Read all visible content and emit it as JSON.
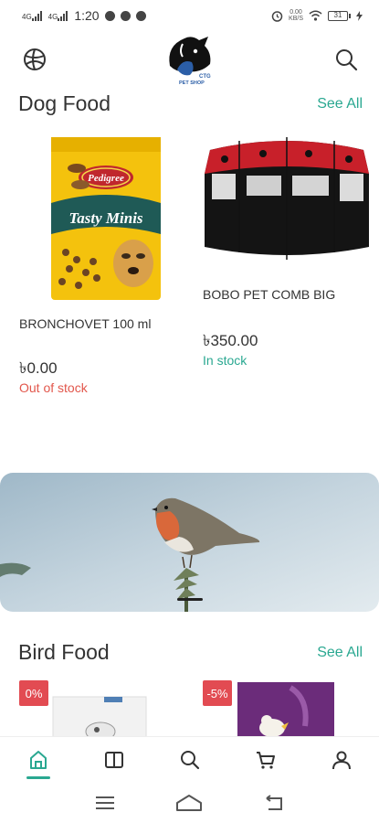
{
  "status_bar": {
    "time": "1:20",
    "signal1_label": "4G",
    "signal2_label": "4G",
    "net_speed_value": "0.00",
    "net_speed_unit": "KB/S",
    "battery_level": "31"
  },
  "header": {
    "logo_line1": "CTG",
    "logo_line2": "PET SHOP"
  },
  "sections": {
    "dog_food": {
      "title": "Dog Food",
      "see_all": "See All",
      "products": [
        {
          "name": "BRONCHOVET 100 ml",
          "price": "৳0.00",
          "stock": "Out of stock",
          "stock_color": "#e2574c",
          "pack_brand": "Pedigree",
          "pack_product": "Tasty Minis"
        },
        {
          "name": "BOBO PET COMB BIG",
          "price": "৳350.00",
          "stock": "In stock",
          "stock_color": "#2aa891"
        }
      ]
    },
    "bird_food": {
      "title": "Bird Food",
      "see_all": "See All",
      "products": [
        {
          "badge": "0%"
        },
        {
          "badge": "-5%"
        }
      ]
    }
  },
  "colors": {
    "accent": "#2aa891",
    "badge": "#e24b52",
    "out_of_stock": "#e2574c"
  },
  "bottom_nav": [
    {
      "icon": "home-icon",
      "active": true
    },
    {
      "icon": "book-icon",
      "active": false
    },
    {
      "icon": "search-icon",
      "active": false
    },
    {
      "icon": "cart-icon",
      "active": false
    },
    {
      "icon": "user-icon",
      "active": false
    }
  ],
  "system_nav": [
    "menu-icon",
    "home-icon",
    "back-icon"
  ]
}
